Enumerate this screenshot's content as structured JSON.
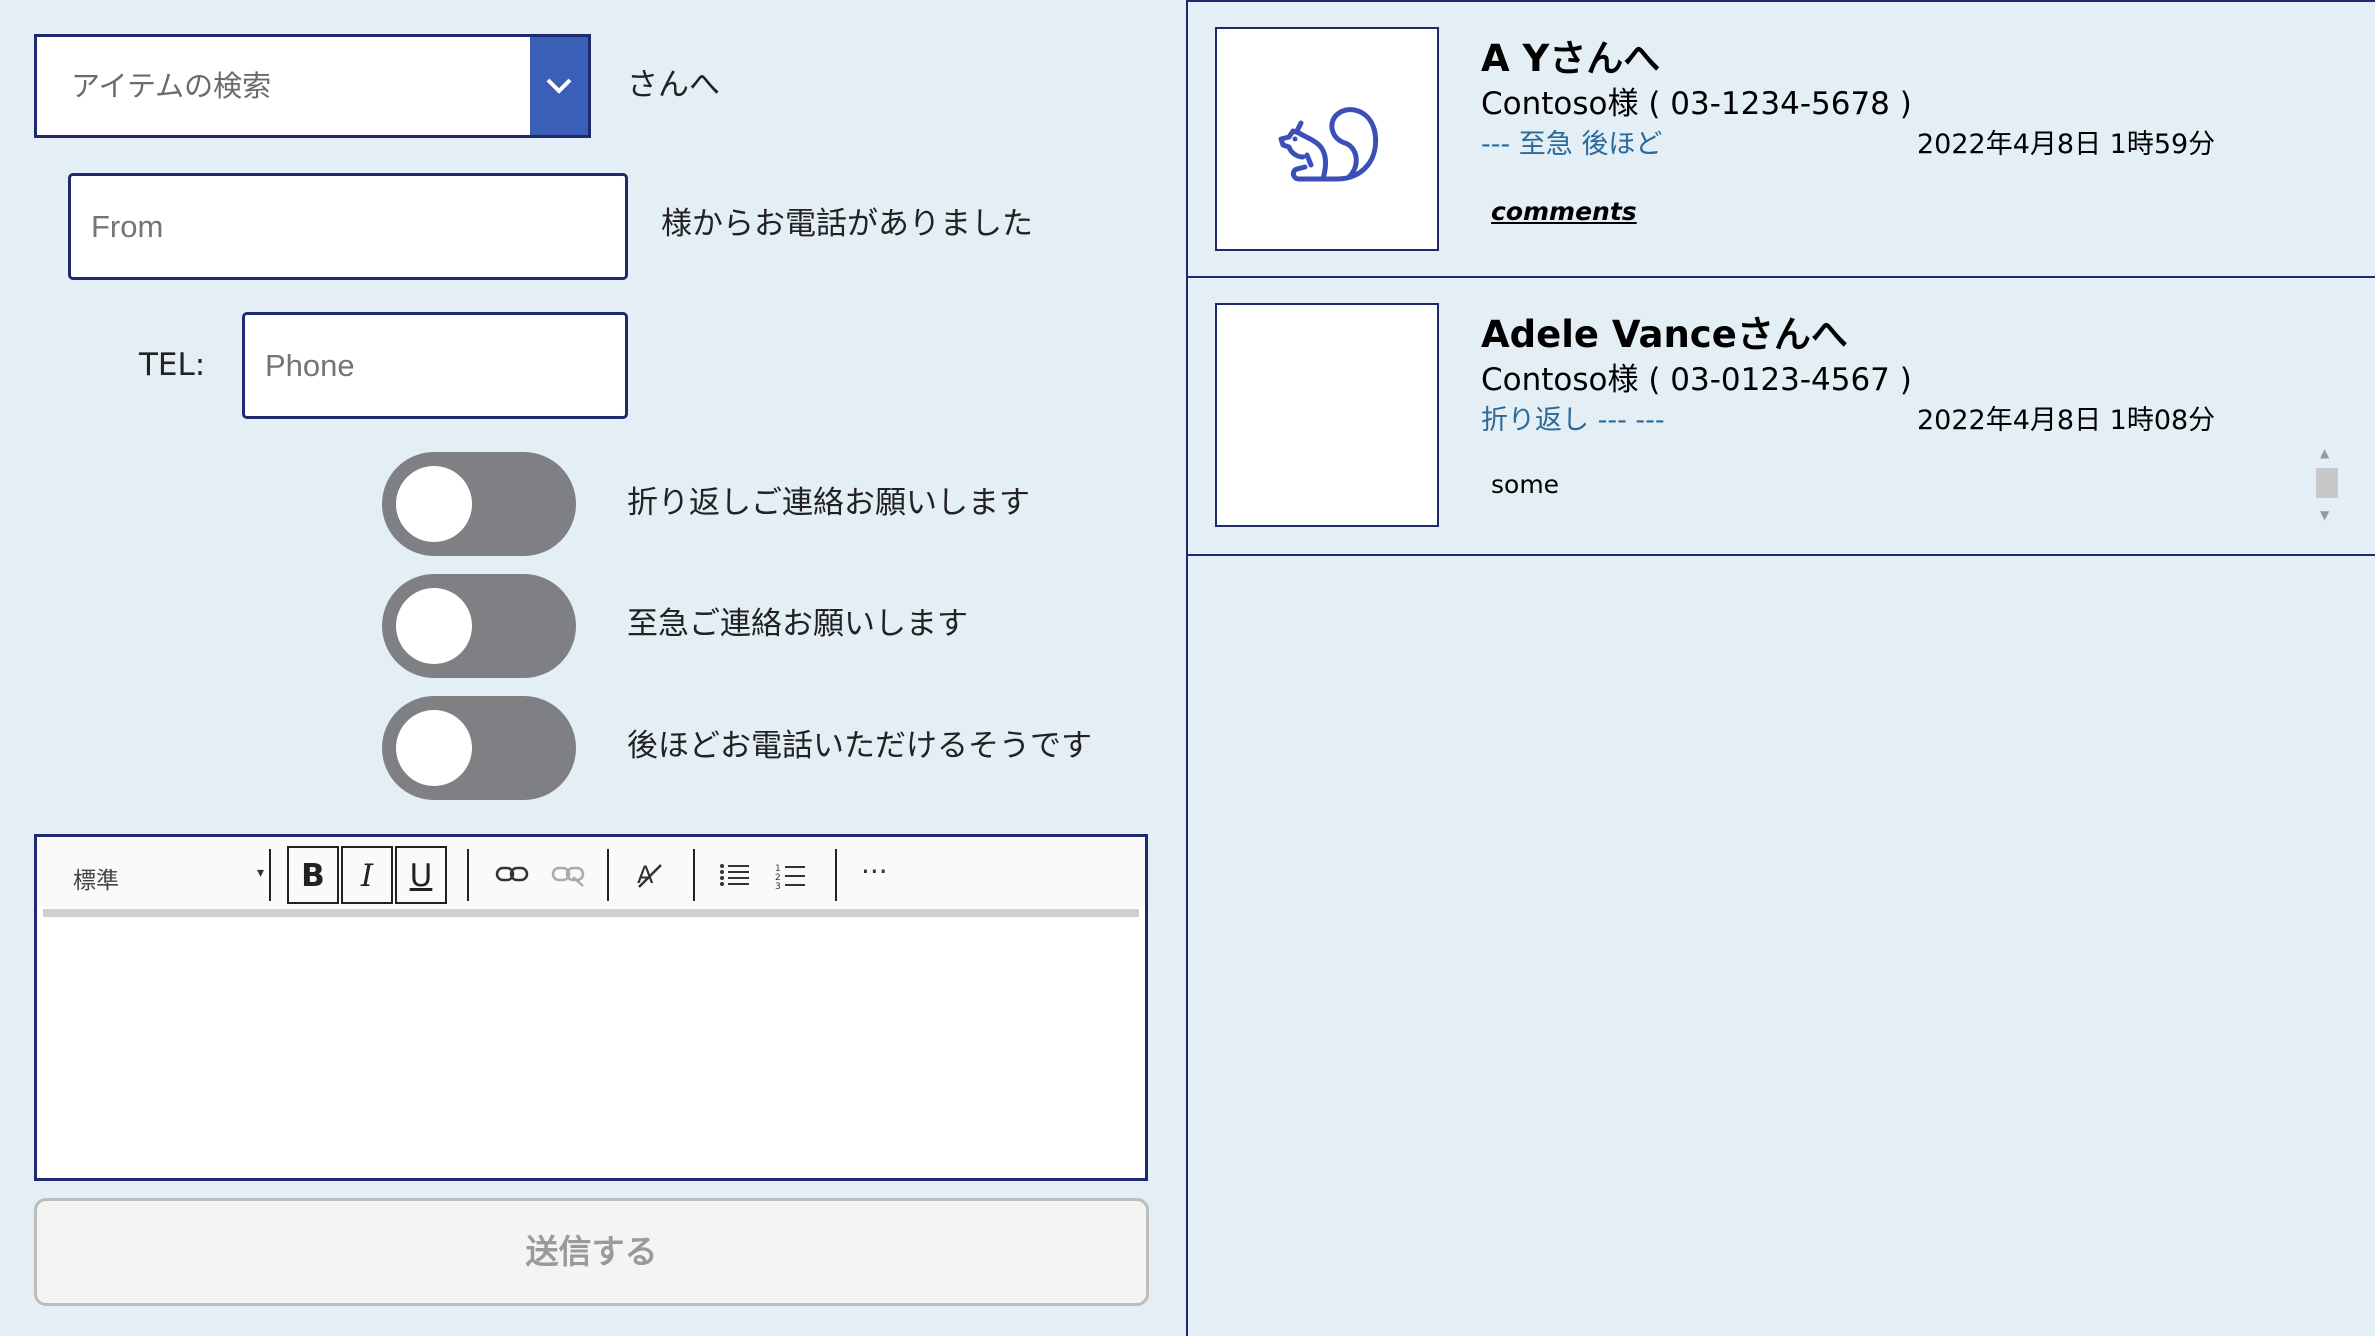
{
  "form": {
    "combo_placeholder": "アイテムの検索",
    "to_suffix": "さんへ",
    "from_placeholder": "From",
    "from_suffix": "様からお電話がありました",
    "tel_label": "TEL:",
    "phone_placeholder": "Phone",
    "toggles": [
      {
        "label": "折り返しご連絡お願いします",
        "on": false
      },
      {
        "label": "至急ご連絡お願いします",
        "on": false
      },
      {
        "label": "後ほどお電話いただけるそうです",
        "on": false
      }
    ],
    "editor": {
      "style_select": "標準",
      "bold": "B",
      "italic": "I",
      "underline": "U",
      "more": "···"
    },
    "send_label": "送信する"
  },
  "gallery": {
    "items": [
      {
        "title": "A Yさんへ",
        "subtitle": "Contoso様 ( 03-1234-5678 )",
        "flags": "--- 至急 後ほど",
        "date": "2022年4月8日 1時59分",
        "comment": "comments",
        "icon": "squirrel-icon"
      },
      {
        "title": "Adele Vanceさんへ",
        "subtitle": "Contoso様 ( 03-0123-4567 )",
        "flags": "折り返し --- ---",
        "date": "2022年4月8日 1時08分",
        "comment": "some",
        "icon": ""
      }
    ]
  },
  "colors": {
    "background": "#e4eef5",
    "accent": "#3b5fb6",
    "border": "#1f2a6e",
    "toggle_off": "#7f8083",
    "flag_text": "#2a6a9a"
  }
}
